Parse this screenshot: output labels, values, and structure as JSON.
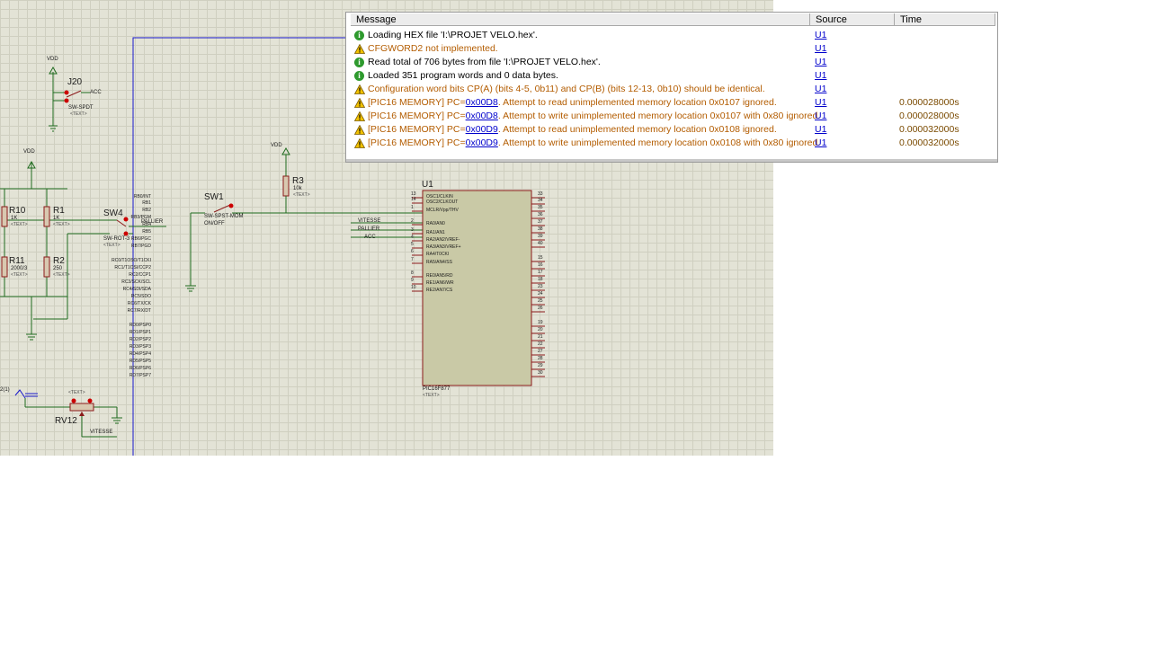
{
  "schematic": {
    "labels": {
      "vdd": "VDD",
      "j20": "J20",
      "acc": "ACC",
      "swspdt": "SW-SPDT",
      "text": "<TEXT>",
      "r10": "R10",
      "r10v": "1K",
      "r1": "R1",
      "r1v": "1K",
      "r11": "R11",
      "r11v": "2000/3",
      "r2": "R2",
      "r2v": "250",
      "sw4": "SW4",
      "sw4type": "SW-ROT-3",
      "pallier": "PALLIER",
      "sw1": "SW1",
      "sw1type": "SW-SPST-MOM",
      "onoff": "ON/OFF",
      "r3": "R3",
      "r3v": "10k",
      "vitesse": "VITESSE",
      "rv12": "RV12",
      "u1": "U1",
      "chip": "PIC16F877",
      "rv_partial": "2(1)"
    },
    "chip_left_pins": [
      {
        "num": "13",
        "name": "OSC1/CLKIN"
      },
      {
        "num": "14",
        "name": "OSC2/CLKOUT"
      },
      {
        "num": "1",
        "name": "MCLR/Vpp/THV"
      },
      {
        "num": "2",
        "name": "RA0/AN0"
      },
      {
        "num": "3",
        "name": "RA1/AN1"
      },
      {
        "num": "4",
        "name": "RA2/AN2/VREF-"
      },
      {
        "num": "5",
        "name": "RA3/AN3/VREF+"
      },
      {
        "num": "6",
        "name": "RA4/T0CKI"
      },
      {
        "num": "7",
        "name": "RA5/AN4/SS"
      },
      {
        "num": "8",
        "name": "RE0/AN5/RD"
      },
      {
        "num": "9",
        "name": "RE1/AN6/WR"
      },
      {
        "num": "10",
        "name": "RE2/AN7/CS"
      }
    ],
    "chip_right_pins": [
      {
        "num": "33",
        "name": "RB0/INT"
      },
      {
        "num": "34",
        "name": "RB1"
      },
      {
        "num": "35",
        "name": "RB2"
      },
      {
        "num": "36",
        "name": "RB3/PGM"
      },
      {
        "num": "37",
        "name": "RB4"
      },
      {
        "num": "38",
        "name": "RB5"
      },
      {
        "num": "39",
        "name": "RB6/PGC"
      },
      {
        "num": "40",
        "name": "RB7/PGD"
      },
      {
        "num": "15",
        "name": "RC0/T1OSO/T1CKI"
      },
      {
        "num": "16",
        "name": "RC1/T1OSI/CCP2"
      },
      {
        "num": "17",
        "name": "RC2/CCP1"
      },
      {
        "num": "18",
        "name": "RC3/SCK/SCL"
      },
      {
        "num": "23",
        "name": "RC4/SDI/SDA"
      },
      {
        "num": "24",
        "name": "RC5/SDO"
      },
      {
        "num": "25",
        "name": "RC6/TX/CK"
      },
      {
        "num": "26",
        "name": "RC7/RX/DT"
      },
      {
        "num": "19",
        "name": "RD0/PSP0"
      },
      {
        "num": "20",
        "name": "RD1/PSP1"
      },
      {
        "num": "21",
        "name": "RD2/PSP2"
      },
      {
        "num": "22",
        "name": "RD3/PSP3"
      },
      {
        "num": "27",
        "name": "RD4/PSP4"
      },
      {
        "num": "28",
        "name": "RD5/PSP5"
      },
      {
        "num": "29",
        "name": "RD6/PSP6"
      },
      {
        "num": "30",
        "name": "RD7/PSP7"
      }
    ]
  },
  "message_log": {
    "columns": {
      "message": "Message",
      "source": "Source",
      "time": "Time"
    },
    "rows": [
      {
        "type": "info",
        "pre": "Loading HEX file 'I:\\PROJET VELO.hex'.",
        "link": "",
        "post": "",
        "source": "U1",
        "time": ""
      },
      {
        "type": "warn",
        "pre": "CFGWORD2 not implemented.",
        "link": "",
        "post": "",
        "source": "U1",
        "time": ""
      },
      {
        "type": "info",
        "pre": "Read total of 706 bytes from file 'I:\\PROJET VELO.hex'.",
        "link": "",
        "post": "",
        "source": "U1",
        "time": ""
      },
      {
        "type": "info",
        "pre": "Loaded 351 program words and 0 data bytes.",
        "link": "",
        "post": "",
        "source": "U1",
        "time": ""
      },
      {
        "type": "warn",
        "pre": "Configuration word bits CP(A) (bits 4-5, 0b11) and CP(B) (bits 12-13, 0b10) should be identical.",
        "link": "",
        "post": "",
        "source": "U1",
        "time": ""
      },
      {
        "type": "warn",
        "pre": "[PIC16 MEMORY] PC=",
        "link": "0x00D8",
        "post": ". Attempt to read unimplemented memory location 0x0107 ignored.",
        "source": "U1",
        "time": "0.000028000s"
      },
      {
        "type": "warn",
        "pre": "[PIC16 MEMORY] PC=",
        "link": "0x00D8",
        "post": ". Attempt to write unimplemented memory location 0x0107 with 0x80 ignored.",
        "source": "U1",
        "time": "0.000028000s"
      },
      {
        "type": "warn",
        "pre": "[PIC16 MEMORY] PC=",
        "link": "0x00D9",
        "post": ". Attempt to read unimplemented memory location 0x0108 ignored.",
        "source": "U1",
        "time": "0.000032000s"
      },
      {
        "type": "warn",
        "pre": "[PIC16 MEMORY] PC=",
        "link": "0x00D9",
        "post": ". Attempt to write unimplemented memory location 0x0108 with 0x80 ignored.",
        "source": "U1",
        "time": "0.000032000s"
      }
    ]
  },
  "colors": {
    "wire": "#1f6b1f",
    "resistor": "#8b1a1a",
    "bus": "#1a1acc",
    "warn": "#b35c00",
    "info_icon": "#2e9a2e",
    "link": "#0000cc"
  }
}
